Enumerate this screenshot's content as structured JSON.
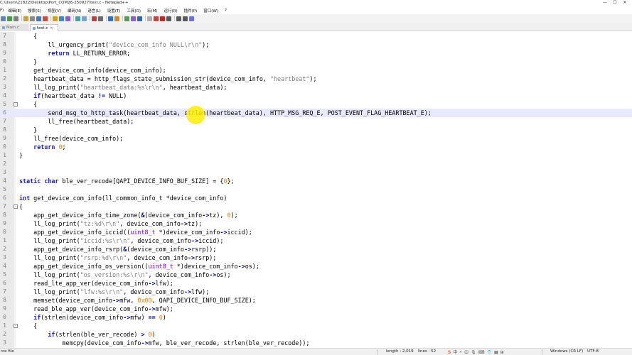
{
  "window": {
    "title": "C:\\Users\\21822\\Desktop\\Port_COM26-250927\\test.c - Notepad++",
    "controls": {
      "minimize": "—",
      "maximize": "☐",
      "close": "✕"
    }
  },
  "menu": {
    "items": [
      "F)",
      "编辑(E)",
      "搜索(S)",
      "视图(V)",
      "编码(N)",
      "语言(L)",
      "设置(T)",
      "工具(O)",
      "宏(M)",
      "运行(R)",
      "插件(P)",
      "窗口(W)",
      "?"
    ]
  },
  "toolbar": {
    "button_colors": [
      "#5f84c4",
      "#4a9a4a",
      "#7f7f7f",
      "#c9a12c",
      "#8a8a8a",
      "#3c7fc8",
      "#c8503c",
      "#d4a020",
      "#2e8bd4",
      "#8a5fc4",
      "#4aa0a0",
      "#7aa0d8",
      "#c04040",
      "#6a6a6a",
      "#3070c8",
      "#d48a20",
      "#50a050",
      "#9060c0",
      "#2c6ab0",
      "#b0b0b0",
      "#c84040",
      "#d02020",
      "#5a5a5a",
      "#5a5a5a",
      "#5a5a5a",
      "#7070d0"
    ]
  },
  "tabs": [
    {
      "label": "Main.c",
      "active": false
    },
    {
      "label": "test.c",
      "active": true
    }
  ],
  "editor": {
    "current_line": "6",
    "lines": [
      {
        "num": "7",
        "fold": "",
        "text": "    {"
      },
      {
        "num": "8",
        "fold": "",
        "text": "        ll_urgency_print(\"device_com_info NULL\\r\\n\");"
      },
      {
        "num": "9",
        "fold": "",
        "text": "        return LL_RETURN_ERROR;"
      },
      {
        "num": "0",
        "fold": "",
        "text": "    }"
      },
      {
        "num": "1",
        "fold": "",
        "text": "    get_device_com_info(device_com_info);"
      },
      {
        "num": "2",
        "fold": "",
        "text": "    heartbeat_data = http_flags_state_submission_str(device_com_info, \"heartbeat\");"
      },
      {
        "num": "3",
        "fold": "",
        "text": "    ll_log_print(\"heartbeat_data:%s\\r\\n\", heartbeat_data);"
      },
      {
        "num": "4",
        "fold": "",
        "text": "    if(heartbeat_data != NULL)"
      },
      {
        "num": "5",
        "fold": "-",
        "text": "    {"
      },
      {
        "num": "6",
        "fold": "",
        "text": "        send_msg_to_http_task(heartbeat_data, strlen(heartbeat_data), HTTP_MSG_REQ_E, POST_EVENT_FLAG_HEARTBEAT_E);"
      },
      {
        "num": "7",
        "fold": "",
        "text": "        ll_free(heartbeat_data);"
      },
      {
        "num": "8",
        "fold": "",
        "text": "    }"
      },
      {
        "num": "9",
        "fold": "",
        "text": "    ll_free(device_com_info);"
      },
      {
        "num": "0",
        "fold": "",
        "text": "    return 0;"
      },
      {
        "num": "1",
        "fold": "",
        "text": "}"
      },
      {
        "num": "2",
        "fold": "",
        "text": ""
      },
      {
        "num": "3",
        "fold": "",
        "text": ""
      },
      {
        "num": "4",
        "fold": "",
        "text": "static char ble_ver_recode[QAPI_DEVICE_INFO_BUF_SIZE] = {0};"
      },
      {
        "num": "5",
        "fold": "",
        "text": ""
      },
      {
        "num": "6",
        "fold": "",
        "text": "int get_device_com_info(ll_common_info_t *device_com_info)"
      },
      {
        "num": "7",
        "fold": "-",
        "text": "{"
      },
      {
        "num": "8",
        "fold": "",
        "text": "    app_get_device_info_time_zone(&(device_com_info->tz), 0);"
      },
      {
        "num": "9",
        "fold": "",
        "text": "    ll_log_print(\"tz:%d\\r\\n\", device_com_info->tz);"
      },
      {
        "num": "0",
        "fold": "",
        "text": "    app_get_device_info_iccid((uint8_t *)device_com_info->iccid);"
      },
      {
        "num": "1",
        "fold": "",
        "text": "    ll_log_print(\"iccid:%s\\r\\n\", device_com_info->iccid);"
      },
      {
        "num": "2",
        "fold": "",
        "text": "    app_get_device_info_rsrp(&(device_com_info->rsrp));"
      },
      {
        "num": "3",
        "fold": "",
        "text": "    ll_log_print(\"rsrp:%d\\r\\n\", device_com_info->rsrp);"
      },
      {
        "num": "4",
        "fold": "",
        "text": "    app_get_device_info_os_version((uint8_t *)device_com_info->os);"
      },
      {
        "num": "5",
        "fold": "",
        "text": "    ll_log_print(\"os_version:%s\\r\\n\", device_com_info->os);"
      },
      {
        "num": "6",
        "fold": "",
        "text": "    read_lte_app_ver(device_com_info->lfw);"
      },
      {
        "num": "7",
        "fold": "",
        "text": "    ll_log_print(\"lfw:%s\\r\\n\", device_com_info->lfw);"
      },
      {
        "num": "8",
        "fold": "",
        "text": "    memset(device_com_info->mfw, 0x00, QAPI_DEVICE_INFO_BUF_SIZE);"
      },
      {
        "num": "9",
        "fold": "",
        "text": "    read_ble_app_ver(device_com_info->mfw);"
      },
      {
        "num": "0",
        "fold": "",
        "text": "    if(strlen(device_com_info->mfw) == 0)"
      },
      {
        "num": "1",
        "fold": "-",
        "text": "    {"
      },
      {
        "num": "2",
        "fold": "",
        "text": "        if(strlen(ble_ver_recode) > 0)"
      },
      {
        "num": "3",
        "fold": "",
        "text": "            memcpy(device_com_info->mfw, ble_ver_recode, strlen(ble_ver_recode));"
      }
    ]
  },
  "statusbar": {
    "file_type": "rce file",
    "length": "length : 2,019",
    "lines": "lines : 52",
    "eol": "Windows (CR LF)",
    "encoding": "UTF-8",
    "tray_icons": [
      "sogou-ime-icon",
      "chinese-mode-icon",
      "punctuation-icon",
      "emoji-icon",
      "mic-icon",
      "keyboard-icon",
      "skin-icon",
      "toolbox-icon",
      "grid-icon"
    ],
    "tray_glyphs": [
      "S",
      "中",
      "•",
      "☺",
      "🎙",
      "⌨",
      "👕",
      "▦",
      "⊞"
    ]
  }
}
